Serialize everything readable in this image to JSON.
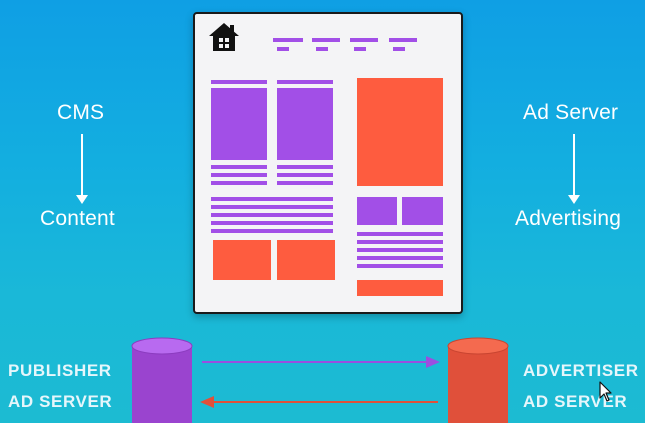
{
  "left_flow": {
    "source": "CMS",
    "target": "Content"
  },
  "right_flow": {
    "source": "Ad Server",
    "target": "Advertising"
  },
  "publisher_server": {
    "line1": "PUBLISHER",
    "line2": "AD SERVER"
  },
  "advertiser_server": {
    "line1": "ADVERTISER",
    "line2": "AD SERVER"
  },
  "colors": {
    "content": "#a24fe7",
    "advertising": "#fe5c3f",
    "background_top": "#0f9fe4",
    "background_bottom": "#1cbbd2"
  },
  "icons": [
    "home-icon",
    "mouse-cursor-icon"
  ]
}
